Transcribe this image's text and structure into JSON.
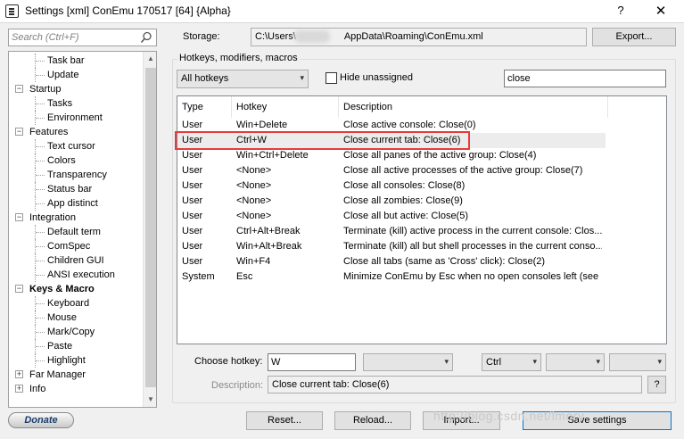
{
  "window": {
    "title": "Settings [xml] ConEmu 170517 [64] {Alpha}",
    "help_glyph": "?",
    "close_glyph": "✕"
  },
  "sidebar": {
    "search_placeholder": "Search (Ctrl+F)",
    "tree": [
      {
        "label": "Task bar",
        "level": 1
      },
      {
        "label": "Update",
        "level": 1
      },
      {
        "label": "Startup",
        "level": 0,
        "expander": "−"
      },
      {
        "label": "Tasks",
        "level": 1
      },
      {
        "label": "Environment",
        "level": 1
      },
      {
        "label": "Features",
        "level": 0,
        "expander": "−"
      },
      {
        "label": "Text cursor",
        "level": 1
      },
      {
        "label": "Colors",
        "level": 1
      },
      {
        "label": "Transparency",
        "level": 1
      },
      {
        "label": "Status bar",
        "level": 1
      },
      {
        "label": "App distinct",
        "level": 1
      },
      {
        "label": "Integration",
        "level": 0,
        "expander": "−"
      },
      {
        "label": "Default term",
        "level": 1
      },
      {
        "label": "ComSpec",
        "level": 1
      },
      {
        "label": "Children GUI",
        "level": 1
      },
      {
        "label": "ANSI execution",
        "level": 1
      },
      {
        "label": "Keys & Macro",
        "level": 0,
        "expander": "−",
        "selected": true
      },
      {
        "label": "Keyboard",
        "level": 1
      },
      {
        "label": "Mouse",
        "level": 1
      },
      {
        "label": "Mark/Copy",
        "level": 1
      },
      {
        "label": "Paste",
        "level": 1
      },
      {
        "label": "Highlight",
        "level": 1
      },
      {
        "label": "Far Manager",
        "level": 0,
        "expander": "+"
      },
      {
        "label": "Info",
        "level": 0,
        "expander": "+"
      }
    ]
  },
  "storage": {
    "label": "Storage:",
    "path_prefix": "C:\\Users\\",
    "path_suffix": "AppData\\Roaming\\ConEmu.xml",
    "export_label": "Export..."
  },
  "hotkeys": {
    "group_title": "Hotkeys, modifiers, macros",
    "scope_selected": "All hotkeys",
    "hide_unassigned_label": "Hide unassigned",
    "hide_unassigned_checked": false,
    "filter_value": "close",
    "columns": [
      "Type",
      "Hotkey",
      "Description"
    ],
    "rows": [
      {
        "type": "User",
        "hotkey": "Win+Delete",
        "desc": "Close active console: Close(0)"
      },
      {
        "type": "User",
        "hotkey": "Ctrl+W",
        "desc": "Close current tab: Close(6)",
        "selected": true
      },
      {
        "type": "User",
        "hotkey": "Win+Ctrl+Delete",
        "desc": "Close all panes of the active group: Close(4)"
      },
      {
        "type": "User",
        "hotkey": "<None>",
        "desc": "Close all active processes of the active group: Close(7)"
      },
      {
        "type": "User",
        "hotkey": "<None>",
        "desc": "Close all consoles: Close(8)"
      },
      {
        "type": "User",
        "hotkey": "<None>",
        "desc": "Close all zombies: Close(9)"
      },
      {
        "type": "User",
        "hotkey": "<None>",
        "desc": "Close all but active: Close(5)"
      },
      {
        "type": "User",
        "hotkey": "Ctrl+Alt+Break",
        "desc": "Terminate (kill) active process in the current console: Clos..."
      },
      {
        "type": "User",
        "hotkey": "Win+Alt+Break",
        "desc": "Terminate (kill) all but shell processes in the current conso..."
      },
      {
        "type": "User",
        "hotkey": "Win+F4",
        "desc": "Close all tabs (same as 'Cross' click): Close(2)"
      },
      {
        "type": "System",
        "hotkey": "Esc",
        "desc": "Minimize ConEmu by Esc when no open consoles left (see ..."
      }
    ]
  },
  "editor": {
    "choose_label": "Choose hotkey:",
    "choose_value": "W",
    "key_combo_value": "",
    "modifier1_value": "Ctrl",
    "modifier2_value": "",
    "modifier3_value": "",
    "description_label": "Description:",
    "description_value": "Close current tab: Close(6)",
    "help_label": "?"
  },
  "footer": {
    "donate_label": "Donate",
    "reset_label": "Reset...",
    "reload_label": "Reload...",
    "import_label": "Import...",
    "save_label": "Save settings",
    "watermark": "http://blog.csdn.net/lmory"
  },
  "colors": {
    "highlight_border": "#e43c3c",
    "default_button_border": "#0078d7",
    "selected_row": "#ececec"
  }
}
